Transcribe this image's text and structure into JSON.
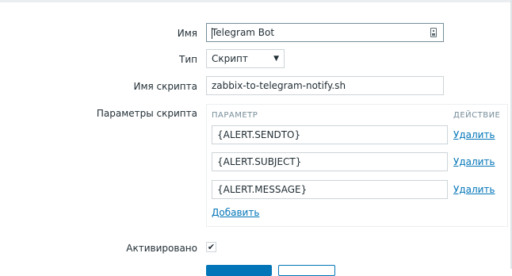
{
  "form": {
    "name": {
      "label": "Имя",
      "value": "Telegram Bot"
    },
    "type": {
      "label": "Тип",
      "value": "Скрипт"
    },
    "script_name": {
      "label": "Имя скрипта",
      "value": "zabbix-to-telegram-notify.sh"
    },
    "script_params": {
      "label": "Параметры скрипта",
      "col_param": "ПАРАМЕТР",
      "col_action": "ДЕЙСТВИЕ",
      "rows": [
        {
          "value": "{ALERT.SENDTO}",
          "action": "Удалить"
        },
        {
          "value": "{ALERT.SUBJECT}",
          "action": "Удалить"
        },
        {
          "value": "{ALERT.MESSAGE}",
          "action": "Удалить"
        }
      ],
      "add_label": "Добавить"
    },
    "enabled": {
      "label": "Активировано",
      "checked": true,
      "check_glyph": "✔"
    }
  },
  "colors": {
    "link": "#0275b8",
    "primary_button": "#0275b8",
    "border": "#cdd4d8"
  }
}
